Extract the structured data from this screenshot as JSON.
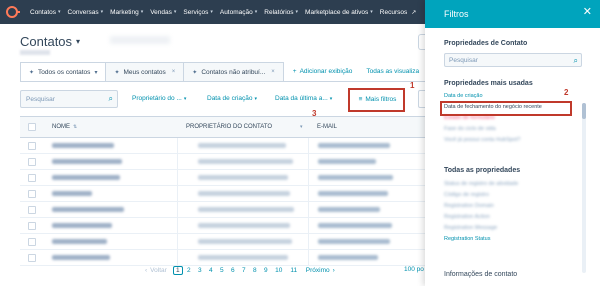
{
  "topnav": {
    "items": [
      {
        "label": "Contatos",
        "caret": true
      },
      {
        "label": "Conversas",
        "caret": true
      },
      {
        "label": "Marketing",
        "caret": true
      },
      {
        "label": "Vendas",
        "caret": true
      },
      {
        "label": "Serviços",
        "caret": true
      },
      {
        "label": "Automação",
        "caret": true
      },
      {
        "label": "Relatórios",
        "caret": true
      },
      {
        "label": "Marketplace de ativos",
        "caret": true
      },
      {
        "label": "Recursos",
        "caret": false
      }
    ]
  },
  "header": {
    "title": "Contatos",
    "title_caret": "▾"
  },
  "tabs": {
    "items": [
      "Todos os contatos",
      "Meus contatos",
      "Contatos não atribuí..."
    ],
    "add_view": "Adicionar exibição",
    "all_views": "Todas as visualiza"
  },
  "filterbar": {
    "search_placeholder": "Pesquisar",
    "buttons": [
      "Proprietário do ...",
      "Data de criação",
      "Data da última a..."
    ],
    "more_filters": "Mais filtros"
  },
  "annotations": {
    "one": "1",
    "two": "2",
    "three": "3"
  },
  "table": {
    "columns": {
      "name": "NOME",
      "owner": "PROPRIETÁRIO DO CONTATO",
      "email": "E-MAIL"
    },
    "row_count": 8
  },
  "pagination": {
    "prev": "Voltar",
    "pages": [
      "1",
      "2",
      "3",
      "4",
      "5",
      "6",
      "7",
      "8",
      "9",
      "10",
      "11"
    ],
    "current": "1",
    "next": "Próximo",
    "per_page": "100 po"
  },
  "panel": {
    "title": "Filtros",
    "section_title": "Propriedades de Contato",
    "search_placeholder": "Pesquisar",
    "most_used_title": "Propriedades mais usadas",
    "most_used": [
      {
        "label": "Data de criação",
        "style": "link"
      },
      {
        "label": "Data de fechamento do negócio recente",
        "style": "highlight"
      },
      {
        "label": "Estado de formulário",
        "style": "blurred-pink"
      },
      {
        "label": "Fase do ciclo de vida",
        "style": "blurred"
      },
      {
        "label": "Você já possui conta HubSpot?",
        "style": "blurred"
      }
    ],
    "all_title": "Todas as propriedades",
    "all": [
      {
        "label": "Status de registro de atividade",
        "style": "blurred"
      },
      {
        "label": "Código de registro",
        "style": "blurred"
      },
      {
        "label": "Registration Domain",
        "style": "blurred"
      },
      {
        "label": "Registration Action",
        "style": "blurred"
      },
      {
        "label": "Registration Message",
        "style": "blurred"
      },
      {
        "label": "Registration Status",
        "style": "link"
      }
    ],
    "info_title": "Informações de contato"
  }
}
